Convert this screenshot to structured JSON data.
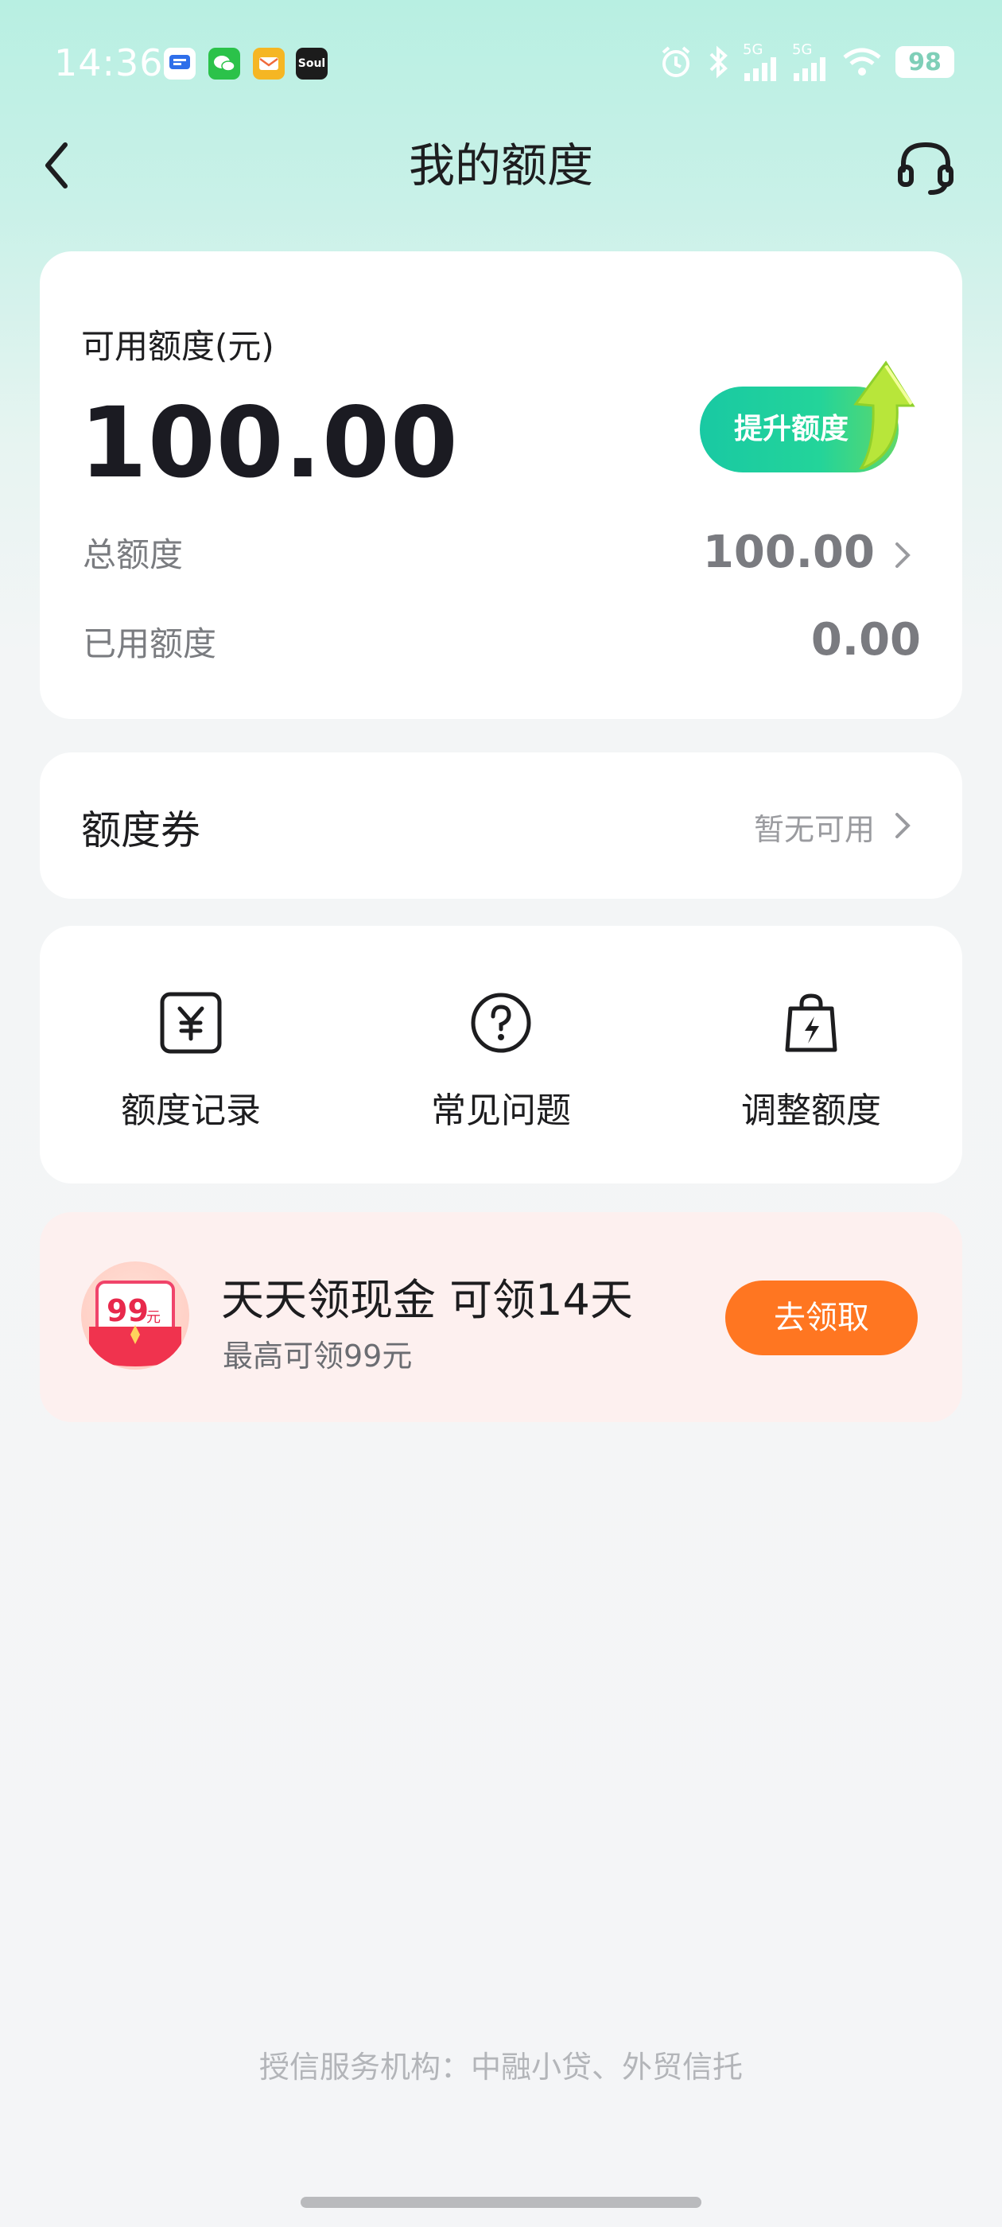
{
  "status_bar": {
    "time": "14:36",
    "app_icons": [
      "message-app-icon",
      "wechat-icon",
      "mail-icon",
      "soul-app-icon"
    ],
    "soul_label": "Soul",
    "network_1": "5G",
    "network_2": "5G",
    "battery": "98"
  },
  "nav": {
    "title": "我的额度"
  },
  "quota": {
    "available_label": "可用额度(元)",
    "available_amount": "100.00",
    "raise_button": "提升额度",
    "total_label": "总额度",
    "total_value": "100.00",
    "used_label": "已用额度",
    "used_value": "0.00"
  },
  "coupon": {
    "title": "额度券",
    "status": "暂无可用"
  },
  "menu": {
    "items": [
      {
        "label": "额度记录",
        "icon": "yuan-record-icon"
      },
      {
        "label": "常见问题",
        "icon": "question-circle-icon"
      },
      {
        "label": "调整额度",
        "icon": "bag-lightning-icon"
      }
    ]
  },
  "promo": {
    "badge_value": "99",
    "badge_unit": "元",
    "title": "天天领现金 可领14天",
    "subtitle": "最高可领99元",
    "button": "去领取"
  },
  "footer": {
    "note": "授信服务机构：中融小贷、外贸信托"
  },
  "colors": {
    "accent_green": "#19c9a3",
    "promo_orange": "#ff7621",
    "header_mint": "#b8efe2"
  }
}
